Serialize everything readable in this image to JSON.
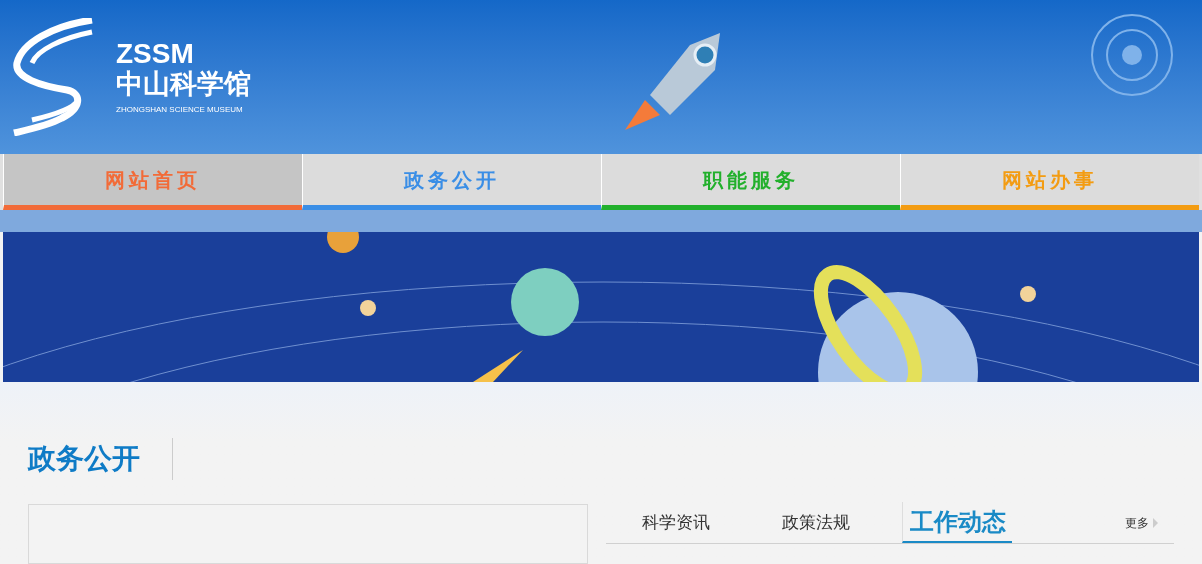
{
  "logo": {
    "abbr": "ZSSM",
    "name": "中山科学馆",
    "english": "ZHONGSHAN SCIENCE MUSEUM"
  },
  "nav": [
    {
      "label": "网站首页",
      "color": "#f26b38",
      "selected": true
    },
    {
      "label": "政务公开",
      "color": "#3a8ee6",
      "selected": false
    },
    {
      "label": "职能服务",
      "color": "#22b02c",
      "selected": false
    },
    {
      "label": "网站办事",
      "color": "#f39c12",
      "selected": false
    }
  ],
  "section": {
    "title": "政务公开"
  },
  "tabs": [
    {
      "label": "科学资讯",
      "selected": false
    },
    {
      "label": "政策法规",
      "selected": false
    },
    {
      "label": "工作动态",
      "selected": true
    }
  ],
  "more": "更多"
}
